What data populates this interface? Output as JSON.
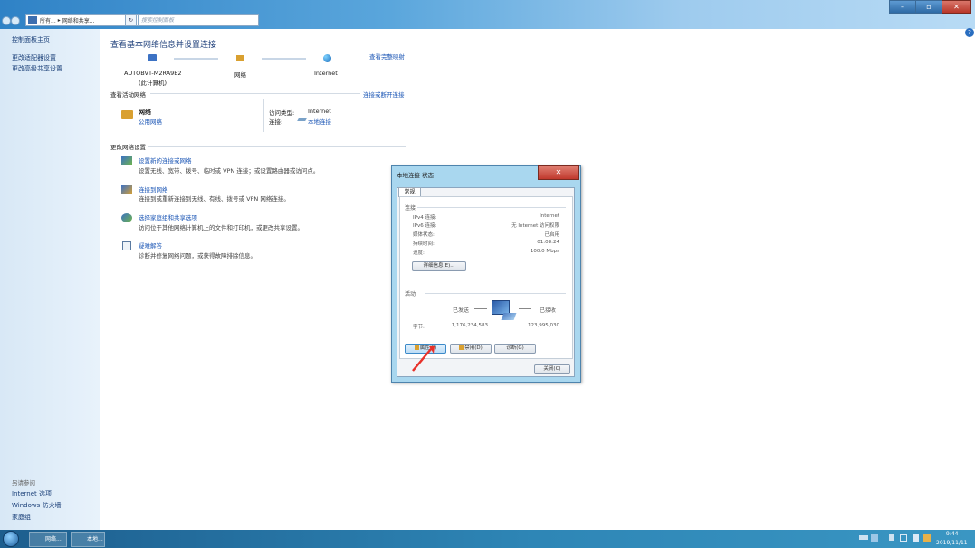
{
  "window": {
    "address_seg1": "所有...",
    "address_seg2": "网络和共享...",
    "search_placeholder": "搜索控制面板",
    "minimize_label": "–",
    "maximize_label": "▫",
    "close_label": "✕",
    "help_label": "?"
  },
  "sidebar": {
    "home": "控制面板主页",
    "links": [
      "更改适配器设置",
      "更改高级共享设置"
    ],
    "see_also_title": "另请参阅",
    "see_also": [
      "Internet 选项",
      "Windows 防火墙",
      "家庭组"
    ]
  },
  "main": {
    "title": "查看基本网络信息并设置连接",
    "view_full_map": "查看完整映射",
    "nodes": [
      {
        "label": "AUTOBVT-M2RA9E2",
        "sub": "(此计算机)",
        "icon": "computer-icon"
      },
      {
        "label": "网络",
        "sub": "",
        "icon": "network-bench-icon"
      },
      {
        "label": "Internet",
        "sub": "",
        "icon": "globe-icon"
      }
    ],
    "active_networks_title": "查看活动网络",
    "connect_disconnect": "连接或断开连接",
    "network_name": "网络",
    "network_type": "公用网络",
    "access_type_label": "访问类型:",
    "access_type_value": "Internet",
    "connections_label": "连接:",
    "connections_value": "本地连接",
    "change_settings_title": "更改网络设置",
    "tasks": [
      {
        "title": "设置新的连接或网络",
        "desc": "设置无线、宽带、拨号、临时或 VPN 连接；或设置路由器或访问点。",
        "icon": "new-connection-icon"
      },
      {
        "title": "连接到网络",
        "desc": "连接到或重新连接到无线、有线、拨号或 VPN 网络连接。",
        "icon": "connect-network-icon"
      },
      {
        "title": "选择家庭组和共享选项",
        "desc": "访问位于其他网络计算机上的文件和打印机，或更改共享设置。",
        "icon": "homegroup-icon"
      },
      {
        "title": "疑难解答",
        "desc": "诊断并修复网络问题，或获得故障排除信息。",
        "icon": "troubleshoot-icon"
      }
    ]
  },
  "dialog": {
    "title": "本地连接 状态",
    "close_label": "✕",
    "tab": "常规",
    "connection_group": "连接",
    "rows": [
      {
        "label": "IPv4 连接:",
        "value": "Internet"
      },
      {
        "label": "IPv6 连接:",
        "value": "无 Internet 访问权限"
      },
      {
        "label": "媒体状态:",
        "value": "已启用"
      },
      {
        "label": "持续时间:",
        "value": "01:08:24"
      },
      {
        "label": "速度:",
        "value": "100.0 Mbps"
      }
    ],
    "details_button": "详细信息(E)...",
    "activity_group": "活动",
    "sent_label": "已发送",
    "received_label": "已接收",
    "bytes_label": "字节:",
    "bytes_sent": "1,176,234,583",
    "bytes_received": "123,995,030",
    "properties_button": "属性(P)",
    "disable_button": "禁用(D)",
    "diagnose_button": "诊断(G)",
    "close_button": "关闭(C)"
  },
  "taskbar": {
    "items": [
      "网络...",
      "本地..."
    ],
    "time": "9:44",
    "date": "2019/11/11"
  },
  "colors": {
    "link": "#1a55b5",
    "title_bar": "#2f82c6",
    "taskbar": "#1d5e8e",
    "arrow": "#e8312a"
  }
}
